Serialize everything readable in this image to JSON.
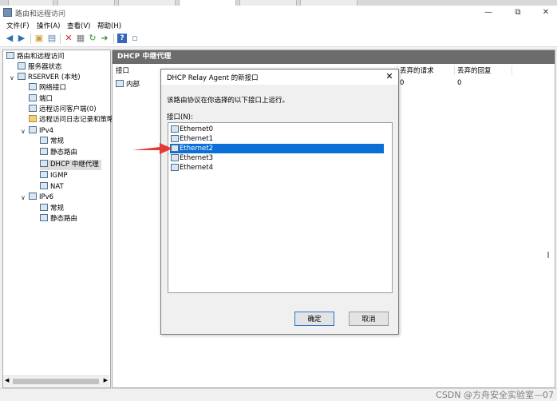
{
  "window": {
    "title": "路由和远程访问",
    "controls": [
      "—",
      "⧉",
      "✕"
    ]
  },
  "menubar": [
    "文件(F)",
    "操作(A)",
    "查看(V)",
    "帮助(H)"
  ],
  "tree": {
    "root": "路由和远程访问",
    "server_status": "服务器状态",
    "server": "RSERVER (本地)",
    "net_interfaces": "网络接口",
    "ports": "端口",
    "remote_clients": "远程访问客户端(0)",
    "remote_logging": "远程访问日志记录和策略",
    "ipv4": "IPv4",
    "ipv4_general": "常规",
    "ipv4_static": "静态路由",
    "dhcp_relay": "DHCP 中继代理",
    "igmp": "IGMP",
    "nat": "NAT",
    "ipv6": "IPv6",
    "ipv6_general": "常规",
    "ipv6_static": "静态路由"
  },
  "right_pane": {
    "header": "DHCP 中继代理",
    "columns": [
      "接口",
      "丢弃的请求",
      "丢弃的回复"
    ],
    "row": {
      "interface": "内部",
      "dropped_requests": "0",
      "dropped_replies": "0"
    }
  },
  "dialog": {
    "title": "DHCP Relay Agent 的新接口",
    "description": "该路由协议在你选择的以下接口上运行。",
    "list_label": "接口(N):",
    "interfaces": [
      "Ethernet0",
      "Ethernet1",
      "Ethernet2",
      "Ethernet3",
      "Ethernet4"
    ],
    "selected": "Ethernet2",
    "ok": "确定",
    "cancel": "取消"
  },
  "watermark": "CSDN @方舟安全实验室—07",
  "colors": {
    "selection": "#0a6fd6",
    "pane_header": "#6c6c6c",
    "arrow": "#e53935"
  }
}
